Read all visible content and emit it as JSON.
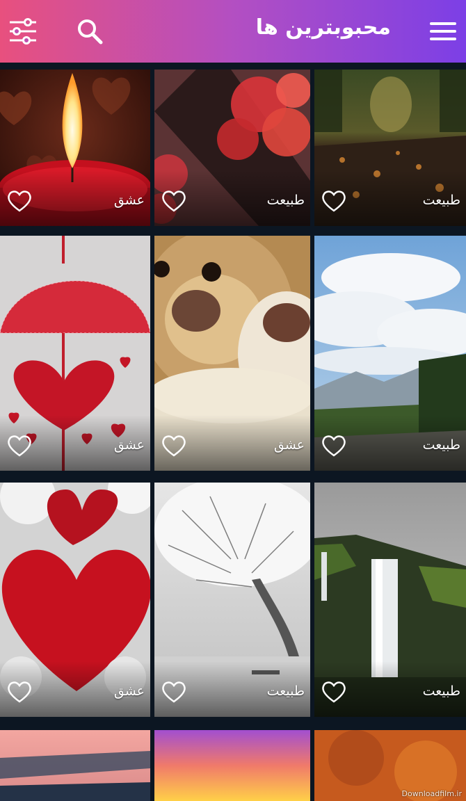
{
  "appbar": {
    "title": "محبوبترین ها",
    "icons": [
      "menu-icon",
      "search-icon",
      "filter-sliders-icon"
    ]
  },
  "tiles": [
    {
      "category": "طبیعت",
      "favorite": false
    },
    {
      "category": "طبیعت",
      "favorite": false
    },
    {
      "category": "عشق",
      "favorite": false
    },
    {
      "category": "طبیعت",
      "favorite": false
    },
    {
      "category": "عشق",
      "favorite": false
    },
    {
      "category": "عشق",
      "favorite": false
    },
    {
      "category": "طبیعت",
      "favorite": false
    },
    {
      "category": "طبیعت",
      "favorite": false
    },
    {
      "category": "عشق",
      "favorite": false
    }
  ],
  "watermark": "Downloadfilm.ir",
  "colors": {
    "appbar_start": "#e8507e",
    "appbar_end": "#7c3fe6",
    "background": "#0c1622"
  }
}
